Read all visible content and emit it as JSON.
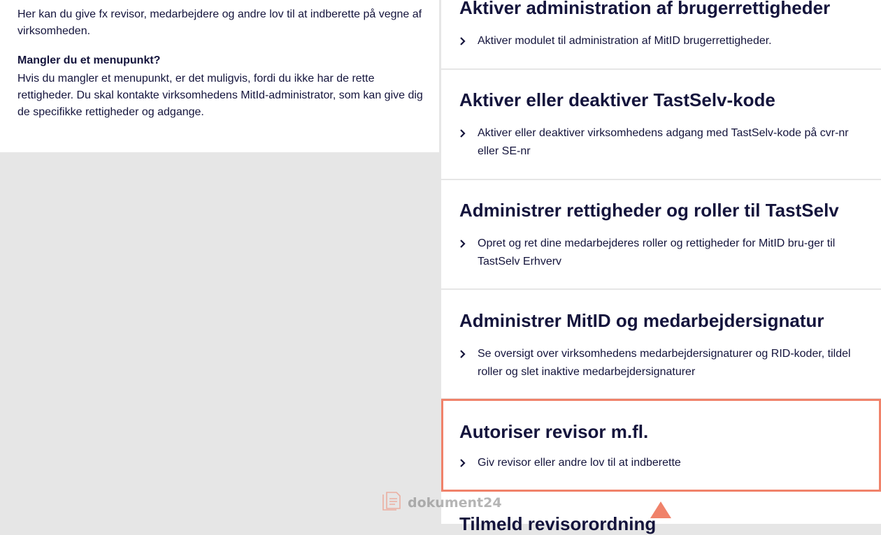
{
  "left": {
    "intro": "Her kan du give fx revisor, medarbejdere og andre lov til at indberette på vegne af virksomheden.",
    "missing_heading": "Mangler du et menupunkt?",
    "missing_text": "Hvis du mangler et menupunkt, er det muligvis, fordi du ikke har de rette rettigheder. Du skal kontakte virksomhedens MitId-administrator, som kan give dig de specifikke rettigheder og adgange."
  },
  "cards": [
    {
      "title": "Aktiver administration af brugerrettigheder",
      "link": "Aktiver modulet til administration af MitID brugerrettigheder."
    },
    {
      "title": "Aktiver eller deaktiver TastSelv-kode",
      "link": "Aktiver eller deaktiver virksomhedens adgang med TastSelv-kode på cvr-nr eller SE-nr"
    },
    {
      "title": "Administrer rettigheder og roller til TastSelv",
      "link": "Opret og ret dine medarbejderes roller og rettigheder for MitID bru-ger til TastSelv Erhverv"
    },
    {
      "title": "Administrer MitID og medarbejdersignatur",
      "link": "Se oversigt over virksomhedens medarbejdersignaturer og RID-koder, tildel roller og slet inaktive medarbejdersignaturer"
    },
    {
      "title": "Autoriser revisor m.fl.",
      "link": "Giv revisor eller andre lov til at indberette"
    },
    {
      "title": "Tilmeld revisorordning",
      "link": ""
    }
  ],
  "watermark": {
    "text": "dokument24",
    "icon": "document-icon"
  },
  "colors": {
    "text": "#14143c",
    "highlight": "#f0826a",
    "background": "#e6e6e6"
  }
}
